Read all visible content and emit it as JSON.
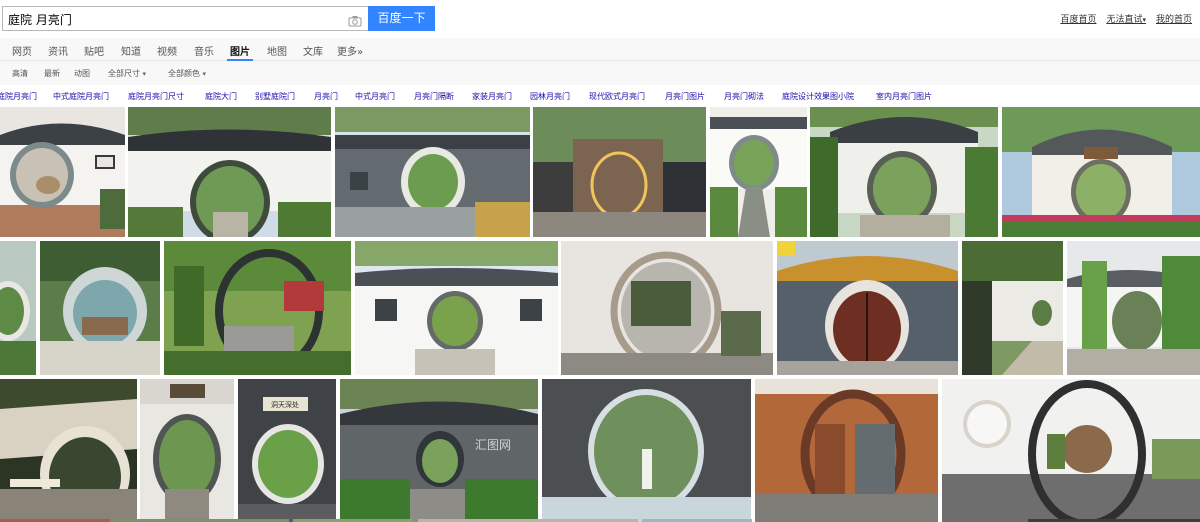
{
  "search": {
    "query": "庭院 月亮门",
    "button_label": "百度一下"
  },
  "top_links": {
    "home": "百度首页",
    "settings": "无法直试",
    "my_page": "我的首页"
  },
  "nav": {
    "tabs": [
      {
        "label": "网页"
      },
      {
        "label": "资讯"
      },
      {
        "label": "贴吧"
      },
      {
        "label": "知道"
      },
      {
        "label": "视频"
      },
      {
        "label": "音乐"
      },
      {
        "label": "图片"
      },
      {
        "label": "地图"
      },
      {
        "label": "文库"
      },
      {
        "label": "更多»"
      }
    ],
    "active_tab": "图片"
  },
  "filters": [
    {
      "label": "高清"
    },
    {
      "label": "最新"
    },
    {
      "label": "动图"
    },
    {
      "label": "全部尺寸"
    },
    {
      "label": "全部颜色"
    }
  ],
  "related": [
    {
      "label": "庭院月亮门"
    },
    {
      "label": "中式庭院月亮门"
    },
    {
      "label": "庭院月亮门尺寸"
    },
    {
      "label": "庭院大门"
    },
    {
      "label": "别墅庭院门"
    },
    {
      "label": "月亮门"
    },
    {
      "label": "中式月亮门"
    },
    {
      "label": "月亮门隔断"
    },
    {
      "label": "家装月亮门"
    },
    {
      "label": "园林月亮门"
    },
    {
      "label": "现代欧式月亮门"
    },
    {
      "label": "月亮门图片"
    },
    {
      "label": "月亮门砌法"
    },
    {
      "label": "庭院设计效果图小院"
    },
    {
      "label": "室内月亮门图片"
    }
  ],
  "images": {
    "watermark": "汇图网",
    "plaque_text": "洞天深处",
    "count": 25
  }
}
